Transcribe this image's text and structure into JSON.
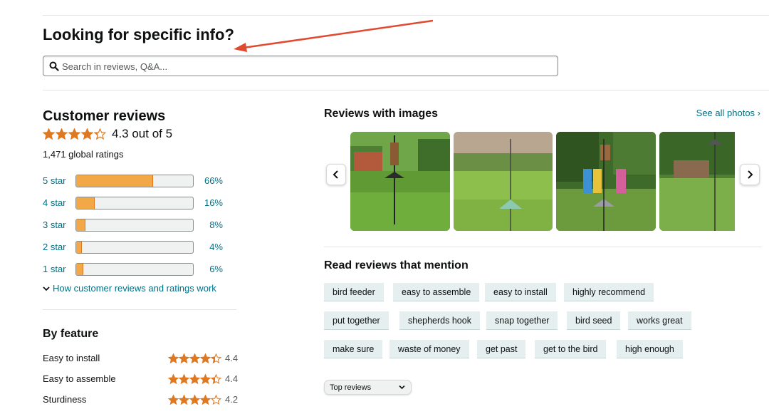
{
  "search": {
    "heading": "Looking for specific info?",
    "placeholder": "Search in reviews, Q&A..."
  },
  "customer_reviews": {
    "title": "Customer reviews",
    "rating_value": 4.3,
    "rating_text": "4.3 out of 5",
    "global_ratings": "1,471 global ratings",
    "histogram": [
      {
        "label": "5 star",
        "percent_text": "66%",
        "percent": 66
      },
      {
        "label": "4 star",
        "percent_text": "16%",
        "percent": 16
      },
      {
        "label": "3 star",
        "percent_text": "8%",
        "percent": 8
      },
      {
        "label": "2 star",
        "percent_text": "4%",
        "percent": 4
      },
      {
        "label": "1 star",
        "percent_text": "6%",
        "percent": 6
      }
    ],
    "how_link": "How customer reviews and ratings work"
  },
  "by_feature": {
    "title": "By feature",
    "items": [
      {
        "name": "Easy to install",
        "rating": "4.4"
      },
      {
        "name": "Easy to assemble",
        "rating": "4.4"
      },
      {
        "name": "Sturdiness",
        "rating": "4.2"
      }
    ]
  },
  "reviews_with_images": {
    "title": "Reviews with images",
    "see_all": "See all photos ›"
  },
  "mentions": {
    "title": "Read reviews that mention",
    "chips": [
      "bird feeder",
      "easy to assemble",
      "easy to install",
      "highly recommend",
      "put together",
      "shepherds hook",
      "snap together",
      "bird seed",
      "works great",
      "make sure",
      "waste of money",
      "get past",
      "get to the bird",
      "high enough"
    ]
  },
  "sort": {
    "selected": "Top reviews"
  },
  "colors": {
    "star": "#de7921",
    "link": "#007185",
    "bar_fill": "#f3a847",
    "arrow": "#e04a2f"
  },
  "icons": [
    "search-icon",
    "star-icon",
    "chevron-down-icon",
    "chevron-left-icon",
    "chevron-right-icon",
    "annotation-arrow"
  ]
}
